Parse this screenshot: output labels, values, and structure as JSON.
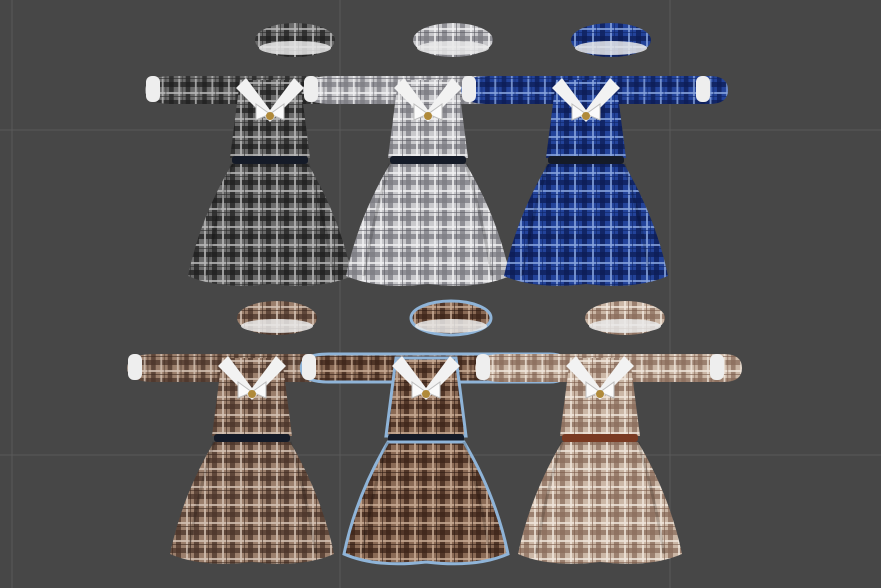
{
  "scene": {
    "background": "#474747",
    "grid_color": "#5a5a5a",
    "selection_outline": "#8fb4d8",
    "selected_index": 4
  },
  "outfits": [
    {
      "name": "black-plaid",
      "base": "#6b6b6b",
      "dark": "#1e1e1e",
      "light": "#b9b9b9",
      "accent": "#2a2a2a",
      "belt": "#151b28"
    },
    {
      "name": "white-plaid",
      "base": "#c9c9cc",
      "dark": "#7c7c82",
      "light": "#f1f1f3",
      "accent": "#5a5a60",
      "belt": "#151b28"
    },
    {
      "name": "blue-plaid",
      "base": "#23439a",
      "dark": "#0c1c55",
      "light": "#8aa6df",
      "accent": "#0f2466",
      "belt": "#151b28"
    },
    {
      "name": "tan-plaid",
      "base": "#9b7f6c",
      "dark": "#4a3429",
      "light": "#d6c4b5",
      "accent": "#3d2a20",
      "belt": "#151b28"
    },
    {
      "name": "brown-plaid",
      "base": "#8a6a55",
      "dark": "#3d2419",
      "light": "#c8ab95",
      "accent": "#2f1a12",
      "belt": "#151b28"
    },
    {
      "name": "cream-plaid",
      "base": "#cbb7a6",
      "dark": "#8a6d5c",
      "light": "#f0e6dc",
      "accent": "#7a5a4a",
      "belt": "#7a3a22"
    }
  ]
}
